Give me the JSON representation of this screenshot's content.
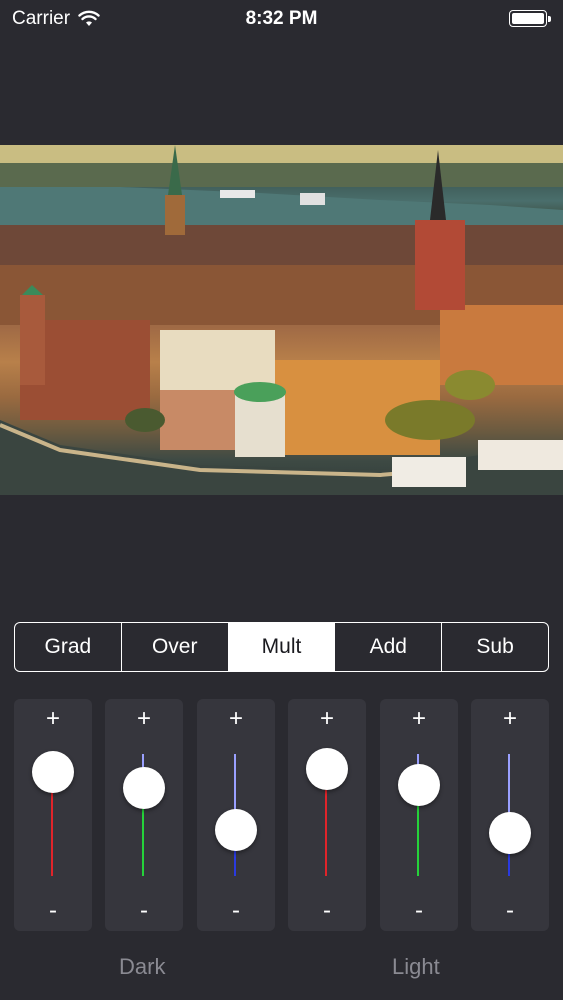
{
  "status_bar": {
    "carrier": "Carrier",
    "time": "8:32 PM",
    "battery_level": 1.0
  },
  "filter_modes": {
    "items": [
      "Grad",
      "Over",
      "Mult",
      "Add",
      "Sub"
    ],
    "selected": "Mult"
  },
  "sliders": [
    {
      "plus": "+",
      "minus": "-",
      "channel_color": "#e0242a",
      "value": 0.85
    },
    {
      "plus": "+",
      "minus": "-",
      "channel_color": "#25d23a",
      "value": 0.72
    },
    {
      "plus": "+",
      "minus": "-",
      "channel_color": "#2a3ae0",
      "value": 0.38
    },
    {
      "plus": "+",
      "minus": "-",
      "channel_color": "#e0242a",
      "value": 0.88
    },
    {
      "plus": "+",
      "minus": "-",
      "channel_color": "#25d23a",
      "value": 0.75
    },
    {
      "plus": "+",
      "minus": "-",
      "channel_color": "#2a3ae0",
      "value": 0.35
    }
  ],
  "labels": {
    "dark": "Dark",
    "light": "Light"
  },
  "colors": {
    "background": "#2a2a30",
    "card": "#36363d",
    "label": "#8a8a92"
  }
}
